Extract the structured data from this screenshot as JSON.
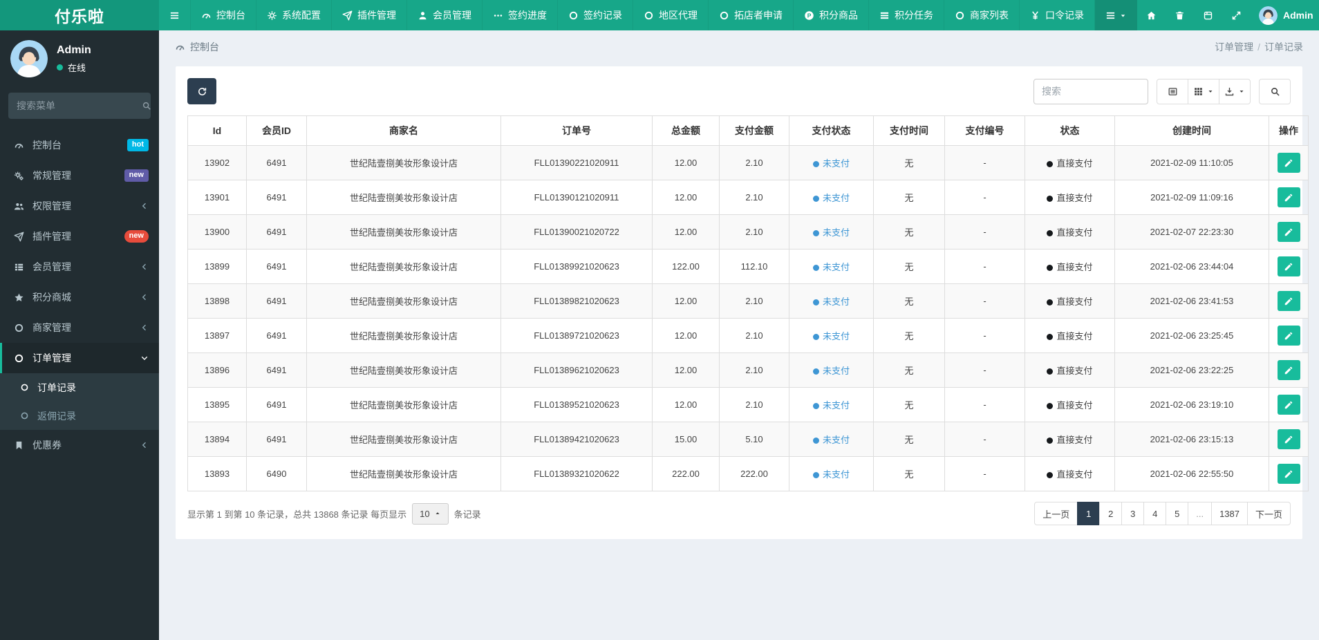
{
  "colors": {
    "accent": "#18bc9c",
    "navbar": "#17a789",
    "brand_bg": "#13977c",
    "sidebar_bg": "#222d32",
    "dark_button": "#2c3e50",
    "unpaid_blue": "#3e96d4",
    "badge_hot": "#00b8e6",
    "badge_new_purple": "#605ca8",
    "badge_new_red": "#e74c3c"
  },
  "navbar": {
    "brand": "付乐啦",
    "items": [
      {
        "icon": "bars",
        "label": ""
      },
      {
        "icon": "dashboard",
        "label": "控制台"
      },
      {
        "icon": "gear",
        "label": "系统配置"
      },
      {
        "icon": "paper-plane",
        "label": "插件管理"
      },
      {
        "icon": "user",
        "label": "会员管理"
      },
      {
        "icon": "ellipsis",
        "label": "签约进度"
      },
      {
        "icon": "circle-o",
        "label": "签约记录"
      },
      {
        "icon": "circle-o",
        "label": "地区代理"
      },
      {
        "icon": "circle-o",
        "label": "拓店者申请"
      },
      {
        "icon": "product-p",
        "label": "积分商品"
      },
      {
        "icon": "tasks",
        "label": "积分任务"
      },
      {
        "icon": "circle-o",
        "label": "商家列表"
      },
      {
        "icon": "yen",
        "label": "口令记录"
      }
    ],
    "right_tools": [
      {
        "icon": "bars",
        "name": "menu-dropdown",
        "caret": true,
        "dark": true
      },
      {
        "icon": "home",
        "name": "home"
      },
      {
        "icon": "trash",
        "name": "clear-cache"
      },
      {
        "icon": "store",
        "name": "module-store"
      },
      {
        "icon": "expand",
        "name": "fullscreen"
      }
    ],
    "user": {
      "name": "Admin"
    },
    "settings_icon": "cogs"
  },
  "sidebar": {
    "user": {
      "name": "Admin",
      "status": "在线"
    },
    "search_placeholder": "搜索菜单",
    "items": [
      {
        "icon": "dashboard",
        "label": "控制台",
        "badge": {
          "text": "hot",
          "color": "#00b8e6",
          "pill": false
        }
      },
      {
        "icon": "cogs",
        "label": "常规管理",
        "badge": {
          "text": "new",
          "color": "#605ca8",
          "pill": false
        }
      },
      {
        "icon": "users",
        "label": "权限管理",
        "chevron": "left"
      },
      {
        "icon": "paper-plane",
        "label": "插件管理",
        "badge": {
          "text": "new",
          "color": "#e74c3c",
          "pill": true
        }
      },
      {
        "icon": "th-list",
        "label": "会员管理",
        "chevron": "left"
      },
      {
        "icon": "star",
        "label": "积分商城",
        "chevron": "left"
      },
      {
        "icon": "circle-o",
        "label": "商家管理",
        "chevron": "left"
      },
      {
        "icon": "circle-o",
        "label": "订单管理",
        "chevron": "down",
        "active": true,
        "children": [
          {
            "icon": "circle-o",
            "label": "订单记录",
            "active": true
          },
          {
            "icon": "circle-o",
            "label": "返佣记录",
            "active": false
          }
        ]
      },
      {
        "icon": "bookmark",
        "label": "优惠券",
        "chevron": "left"
      }
    ]
  },
  "breadcrumb": {
    "section_icon": "dashboard",
    "section": "控制台",
    "trail": [
      "订单管理",
      "订单记录"
    ],
    "separator": "/"
  },
  "toolbar": {
    "refresh_icon": "refresh",
    "search_placeholder": "搜索",
    "buttons": [
      {
        "icon": "list-alt",
        "name": "detail-view",
        "caret": false
      },
      {
        "icon": "th",
        "name": "columns",
        "caret": true
      },
      {
        "icon": "export",
        "name": "export",
        "caret": true
      }
    ],
    "search_button_icon": "search"
  },
  "table": {
    "columns": [
      "Id",
      "会员ID",
      "商家名",
      "订单号",
      "总金额",
      "支付金额",
      "支付状态",
      "支付时间",
      "支付编号",
      "状态",
      "创建时间",
      "操作"
    ],
    "rows": [
      {
        "id": "13902",
        "member_id": "6491",
        "merchant": "世纪陆壹捌美妆形象设计店",
        "order_no": "FLL01390221020911",
        "total": "12.00",
        "paid": "2.10",
        "pay_status": "未支付",
        "pay_time": "无",
        "pay_no": "-",
        "status": "直接支付",
        "created": "2021-02-09 11:10:05"
      },
      {
        "id": "13901",
        "member_id": "6491",
        "merchant": "世纪陆壹捌美妆形象设计店",
        "order_no": "FLL01390121020911",
        "total": "12.00",
        "paid": "2.10",
        "pay_status": "未支付",
        "pay_time": "无",
        "pay_no": "-",
        "status": "直接支付",
        "created": "2021-02-09 11:09:16"
      },
      {
        "id": "13900",
        "member_id": "6491",
        "merchant": "世纪陆壹捌美妆形象设计店",
        "order_no": "FLL01390021020722",
        "total": "12.00",
        "paid": "2.10",
        "pay_status": "未支付",
        "pay_time": "无",
        "pay_no": "-",
        "status": "直接支付",
        "created": "2021-02-07 22:23:30"
      },
      {
        "id": "13899",
        "member_id": "6491",
        "merchant": "世纪陆壹捌美妆形象设计店",
        "order_no": "FLL01389921020623",
        "total": "122.00",
        "paid": "112.10",
        "pay_status": "未支付",
        "pay_time": "无",
        "pay_no": "-",
        "status": "直接支付",
        "created": "2021-02-06 23:44:04"
      },
      {
        "id": "13898",
        "member_id": "6491",
        "merchant": "世纪陆壹捌美妆形象设计店",
        "order_no": "FLL01389821020623",
        "total": "12.00",
        "paid": "2.10",
        "pay_status": "未支付",
        "pay_time": "无",
        "pay_no": "-",
        "status": "直接支付",
        "created": "2021-02-06 23:41:53"
      },
      {
        "id": "13897",
        "member_id": "6491",
        "merchant": "世纪陆壹捌美妆形象设计店",
        "order_no": "FLL01389721020623",
        "total": "12.00",
        "paid": "2.10",
        "pay_status": "未支付",
        "pay_time": "无",
        "pay_no": "-",
        "status": "直接支付",
        "created": "2021-02-06 23:25:45"
      },
      {
        "id": "13896",
        "member_id": "6491",
        "merchant": "世纪陆壹捌美妆形象设计店",
        "order_no": "FLL01389621020623",
        "total": "12.00",
        "paid": "2.10",
        "pay_status": "未支付",
        "pay_time": "无",
        "pay_no": "-",
        "status": "直接支付",
        "created": "2021-02-06 23:22:25"
      },
      {
        "id": "13895",
        "member_id": "6491",
        "merchant": "世纪陆壹捌美妆形象设计店",
        "order_no": "FLL01389521020623",
        "total": "12.00",
        "paid": "2.10",
        "pay_status": "未支付",
        "pay_time": "无",
        "pay_no": "-",
        "status": "直接支付",
        "created": "2021-02-06 23:19:10"
      },
      {
        "id": "13894",
        "member_id": "6491",
        "merchant": "世纪陆壹捌美妆形象设计店",
        "order_no": "FLL01389421020623",
        "total": "15.00",
        "paid": "5.10",
        "pay_status": "未支付",
        "pay_time": "无",
        "pay_no": "-",
        "status": "直接支付",
        "created": "2021-02-06 23:15:13"
      },
      {
        "id": "13893",
        "member_id": "6490",
        "merchant": "世纪陆壹捌美妆形象设计店",
        "order_no": "FLL01389321020622",
        "total": "222.00",
        "paid": "222.00",
        "pay_status": "未支付",
        "pay_time": "无",
        "pay_no": "-",
        "status": "直接支付",
        "created": "2021-02-06 22:55:50"
      }
    ]
  },
  "footer": {
    "summary_prefix": "显示第 1 到第 10 条记录，总共 13868 条记录 每页显示",
    "page_size": "10",
    "summary_suffix": "条记录",
    "pagination": [
      "上一页",
      "1",
      "2",
      "3",
      "4",
      "5",
      "...",
      "1387",
      "下一页"
    ],
    "active_page": "1",
    "ellipsis": "..."
  }
}
